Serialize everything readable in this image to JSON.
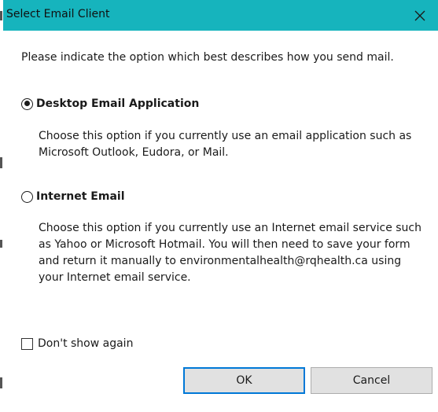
{
  "window": {
    "title": "Select Email Client",
    "close_icon": "close-icon",
    "titlebar_color": "#16b4bd",
    "accent_color": "#0078d7"
  },
  "intro_text": "Please indicate the option which best describes how you send mail.",
  "options": [
    {
      "label": "Desktop Email Application",
      "selected": true,
      "description": "Choose this option if you currently use an email application such as Microsoft Outlook, Eudora, or Mail."
    },
    {
      "label": "Internet Email",
      "selected": false,
      "description": "Choose this option if you currently use an Internet email service such as Yahoo or Microsoft Hotmail. You will then need to save your form and return it manually to environmentalhealth@rqhealth.ca using your Internet email service."
    }
  ],
  "dont_show_again": {
    "label": "Don't show again",
    "checked": false
  },
  "buttons": {
    "ok": "OK",
    "cancel": "Cancel"
  }
}
